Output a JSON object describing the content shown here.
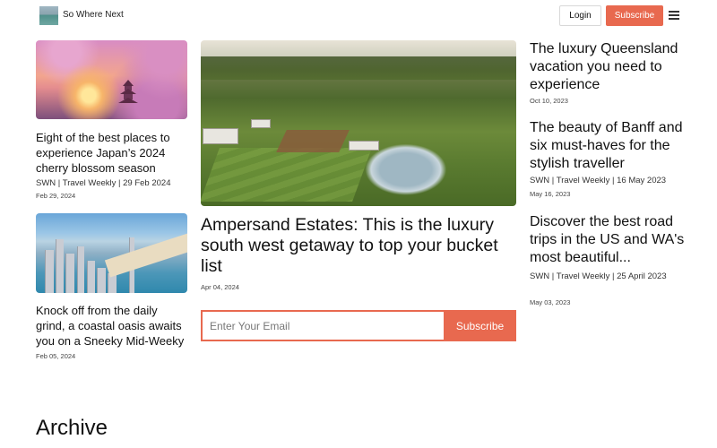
{
  "header": {
    "site_name": "So Where Next",
    "login_label": "Login",
    "subscribe_label": "Subscribe"
  },
  "left_cards": [
    {
      "title": "Eight of the best places to experience Japan’s 2024 cherry blossom season",
      "meta": "SWN | Travel Weekly | 29 Feb 2024",
      "date": "Feb 29, 2024"
    },
    {
      "title": "Knock off from the daily grind, a coastal oasis awaits you on a Sneeky Mid-Weeky",
      "date": "Feb 05, 2024"
    }
  ],
  "feature": {
    "title": "Ampersand Estates: This is the luxury south west getaway to top your bucket list",
    "date": "Apr 04, 2024"
  },
  "newsletter": {
    "placeholder": "Enter Your Email",
    "button_label": "Subscribe"
  },
  "right_articles": [
    {
      "title": "The luxury Queensland vacation you need to experience",
      "date": "Oct 10, 2023"
    },
    {
      "title": "The beauty of Banff and six must-haves for the stylish traveller",
      "meta": "SWN | Travel Weekly | 16 May 2023",
      "date": "May 16, 2023"
    },
    {
      "title": "Discover the best road trips in the US and WA's most beautiful...",
      "meta": "SWN | Travel Weekly | 25 April 2023",
      "date": "May 03, 2023"
    }
  ],
  "archive_heading": "Archive",
  "colors": {
    "accent": "#e8694f"
  }
}
